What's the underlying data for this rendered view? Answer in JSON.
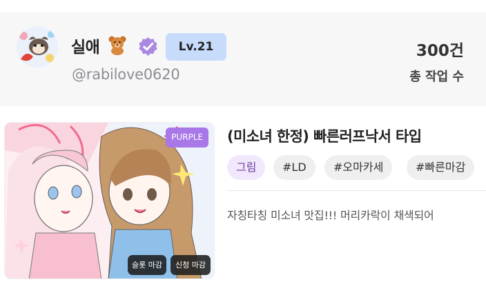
{
  "profile": {
    "name": "실애",
    "name_emoji_icon": "teddy-bear-icon",
    "verified_icon": "verified-badge-icon",
    "level": "Lv.21",
    "handle": "@rabilove0620",
    "work_count": "300건",
    "work_count_label": "총 작업 수"
  },
  "post": {
    "tier_badge": "PURPLE",
    "chips": [
      "슬롯 마감",
      "신청 마감"
    ],
    "title": "(미소녀 한정) 빠른러프낙서 타입",
    "category": "그림",
    "tags": [
      "#LD",
      "#오마카세",
      "#빠른마감"
    ],
    "description": "자칭타칭 미소녀 맛집!!! 머리카락이 채색되어"
  },
  "colors": {
    "level_badge_bg": "#c7dcfb",
    "tier_badge_bg": "#a877e8",
    "verified": "#a98ae0",
    "category_bg": "#f1e8fb"
  }
}
